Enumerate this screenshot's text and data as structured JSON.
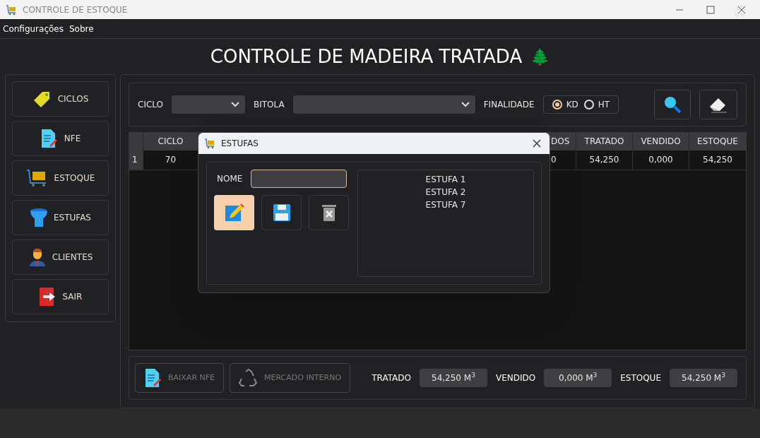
{
  "window": {
    "title": "CONTROLE DE ESTOQUE"
  },
  "menu": [
    "Configurações",
    "Sobre"
  ],
  "heading": {
    "text": "CONTROLE DE MADEIRA TRATADA",
    "emoji": "🌲"
  },
  "sidebar": [
    {
      "label": "CICLOS",
      "kind": "tag"
    },
    {
      "label": "NFE",
      "kind": "document"
    },
    {
      "label": "ESTOQUE",
      "kind": "cart"
    },
    {
      "label": "ESTUFAS",
      "kind": "kiln"
    },
    {
      "label": "CLIENTES",
      "kind": "person"
    },
    {
      "label": "SAIR",
      "kind": "exit"
    }
  ],
  "filters": {
    "ciclo_label": "CICLO",
    "bitola_label": "BITOLA",
    "finalidade_label": "FINALIDADE",
    "finalidade": [
      {
        "label": "KD",
        "selected": true
      },
      {
        "label": "HT",
        "selected": false
      }
    ]
  },
  "table": {
    "columns": [
      "CICLO",
      "DOS",
      "TRATADO",
      "VENDIDO",
      "ESTOQUE"
    ],
    "rows": [
      {
        "number": "1",
        "cells": [
          "70",
          "0",
          "54,250",
          "0,000",
          "54,250"
        ]
      }
    ]
  },
  "footer": {
    "buttons": [
      {
        "label": "BAIXAR NFE",
        "kind": "document",
        "disabled": true
      },
      {
        "label": "MERCADO INTERNO",
        "kind": "recycle",
        "disabled": true
      }
    ],
    "totals": [
      {
        "label": "TRATADO",
        "value": "54,250 M$^{3}$"
      },
      {
        "label": "VENDIDO",
        "value": "0,000 M$^{3}$"
      },
      {
        "label": "ESTOQUE",
        "value": "54,250 M$^{3}$"
      }
    ]
  },
  "dialog": {
    "title": "ESTUFAS",
    "name_label": "NOME",
    "actions": [
      {
        "kind": "edit",
        "selected": true
      },
      {
        "kind": "save",
        "selected": false
      },
      {
        "kind": "delete",
        "selected": false
      }
    ],
    "items": [
      "ESTUFA 1",
      "ESTUFA 2",
      "ESTUFA 7"
    ]
  }
}
